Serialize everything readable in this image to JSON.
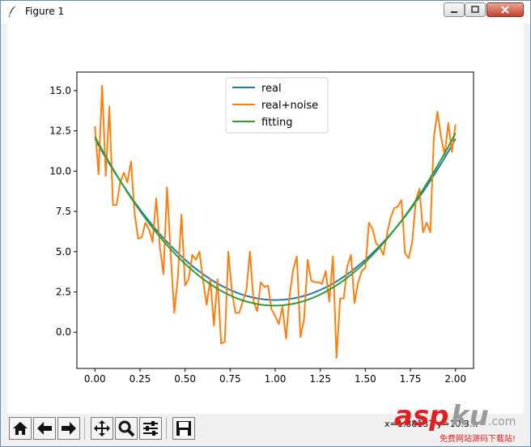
{
  "window": {
    "title": "Figure 1"
  },
  "toolbar": {
    "buttons": [
      "home-icon",
      "back-icon",
      "forward-icon",
      "pan-icon",
      "zoom-icon",
      "configure-subplots-icon",
      "save-icon"
    ],
    "coords_text": "x=1.88137 y=10.3..."
  },
  "chart_data": {
    "type": "line",
    "xlim": [
      -0.1,
      2.1
    ],
    "ylim": [
      -2.25,
      16.15
    ],
    "x_ticks": [
      0.0,
      0.25,
      0.5,
      0.75,
      1.0,
      1.25,
      1.5,
      1.75,
      2.0
    ],
    "x_tick_labels": [
      "0.00",
      "0.25",
      "0.50",
      "0.75",
      "1.00",
      "1.25",
      "1.50",
      "1.75",
      "2.00"
    ],
    "y_ticks": [
      0.0,
      2.5,
      5.0,
      7.5,
      10.0,
      12.5,
      15.0
    ],
    "y_tick_labels": [
      "0.0",
      "2.5",
      "5.0",
      "7.5",
      "10.0",
      "12.5",
      "15.0"
    ],
    "legend_position": "upper center",
    "grid": false,
    "series": [
      {
        "name": "real",
        "color": "#1f77b4",
        "kind": "quadratic",
        "a": 10,
        "b": 1,
        "c": 2,
        "x_range": [
          0,
          2
        ]
      },
      {
        "name": "real+noise",
        "color": "#ff7f0e",
        "kind": "points",
        "x": [
          0.0,
          0.02,
          0.04,
          0.06,
          0.08,
          0.1,
          0.12,
          0.14,
          0.16,
          0.18,
          0.2,
          0.22,
          0.24,
          0.26,
          0.28,
          0.3,
          0.32,
          0.34,
          0.36,
          0.38,
          0.4,
          0.42,
          0.44,
          0.46,
          0.48,
          0.5,
          0.52,
          0.54,
          0.56,
          0.58,
          0.6,
          0.62,
          0.64,
          0.66,
          0.68,
          0.7,
          0.72,
          0.74,
          0.76,
          0.78,
          0.8,
          0.82,
          0.84,
          0.86,
          0.88,
          0.9,
          0.92,
          0.94,
          0.96,
          0.98,
          1.0,
          1.02,
          1.04,
          1.06,
          1.08,
          1.1,
          1.12,
          1.14,
          1.16,
          1.18,
          1.2,
          1.22,
          1.24,
          1.26,
          1.28,
          1.3,
          1.32,
          1.34,
          1.36,
          1.38,
          1.4,
          1.42,
          1.44,
          1.46,
          1.48,
          1.5,
          1.52,
          1.54,
          1.56,
          1.58,
          1.6,
          1.62,
          1.64,
          1.66,
          1.68,
          1.7,
          1.72,
          1.74,
          1.76,
          1.78,
          1.8,
          1.82,
          1.84,
          1.86,
          1.88,
          1.9,
          1.92,
          1.94,
          1.96,
          1.98,
          2.0
        ],
        "y": [
          12.8,
          9.8,
          15.3,
          9.7,
          14.0,
          7.9,
          7.9,
          9.3,
          9.9,
          9.3,
          10.6,
          7.4,
          5.8,
          5.9,
          6.8,
          6.4,
          5.6,
          8.3,
          5.3,
          3.6,
          9.0,
          4.9,
          1.2,
          3.4,
          7.3,
          2.9,
          3.3,
          4.8,
          4.5,
          5.0,
          3.2,
          1.7,
          3.3,
          0.4,
          3.3,
          -0.7,
          -0.6,
          5.0,
          2.5,
          1.2,
          1.2,
          1.9,
          2.6,
          5.0,
          1.9,
          1.3,
          3.1,
          2.8,
          2.9,
          1.4,
          1.0,
          0.5,
          1.6,
          -0.4,
          2.3,
          3.9,
          4.7,
          -0.3,
          0.8,
          4.5,
          3.2,
          3.1,
          3.1,
          3.0,
          3.8,
          1.9,
          4.7,
          -1.6,
          2.1,
          2.1,
          4.1,
          4.8,
          1.8,
          3.1,
          3.8,
          4.0,
          6.8,
          6.4,
          5.5,
          5.3,
          4.8,
          6.1,
          7.1,
          7.7,
          7.8,
          8.2,
          4.9,
          4.6,
          5.6,
          8.2,
          8.9,
          6.2,
          6.8,
          6.2,
          12.1,
          13.7,
          12.1,
          11.0,
          13.0,
          11.2,
          12.9
        ]
      },
      {
        "name": "fitting",
        "color": "#2ca02c",
        "kind": "quadratic",
        "a": 10.6,
        "b": 0.995,
        "c": 1.65,
        "x_range": [
          0,
          2
        ]
      }
    ]
  },
  "watermark": {
    "brand": "asp",
    "brand_accent": "ku",
    "domain": ".com",
    "subtitle": "免费网站源码下载站!"
  }
}
